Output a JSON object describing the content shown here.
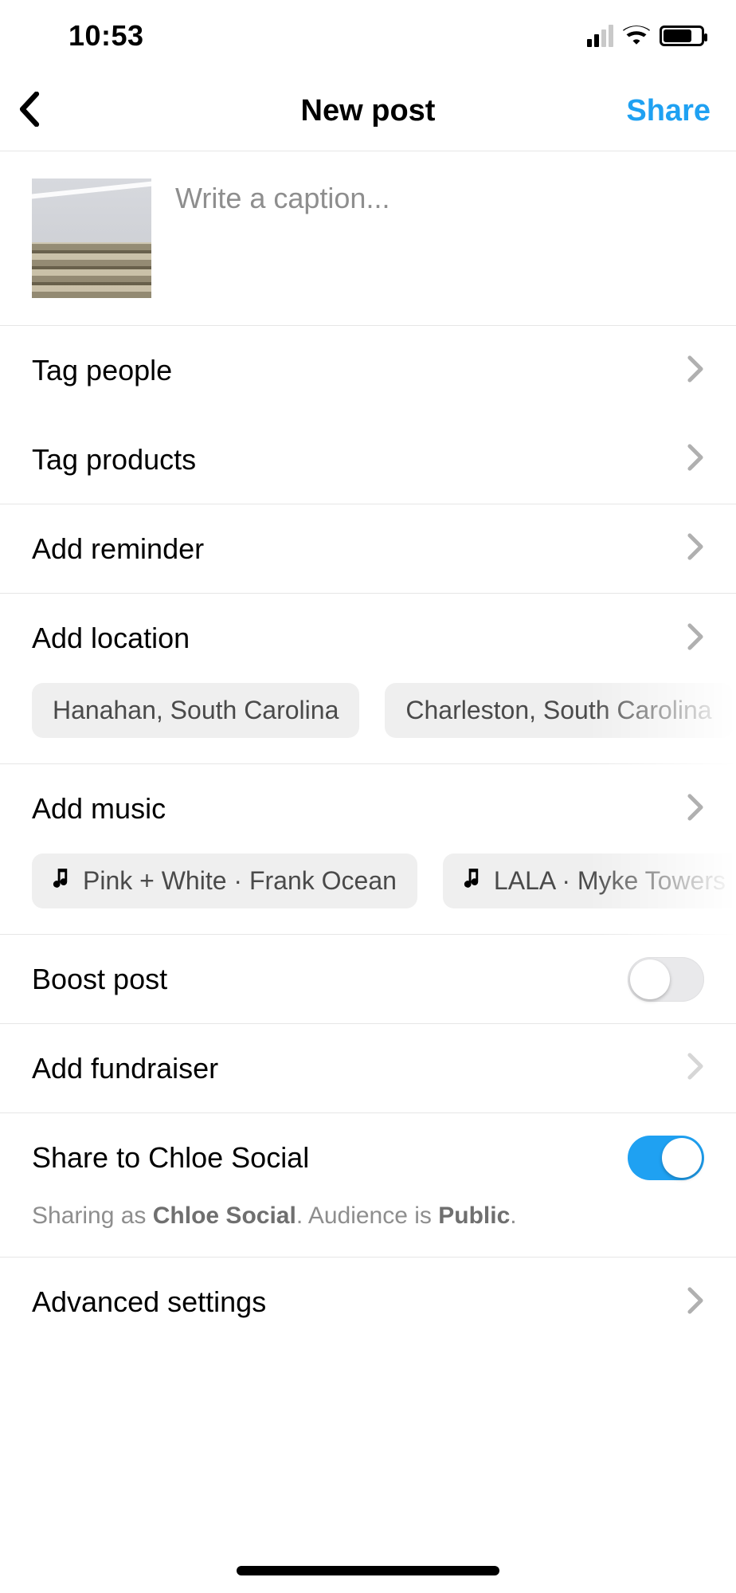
{
  "statusbar": {
    "time": "10:53"
  },
  "header": {
    "title": "New post",
    "share_label": "Share"
  },
  "caption": {
    "placeholder": "Write a caption..."
  },
  "rows": {
    "tag_people": "Tag people",
    "tag_products": "Tag products",
    "add_reminder": "Add reminder",
    "add_location": "Add location",
    "add_music": "Add music",
    "boost_post": "Boost post",
    "add_fundraiser": "Add fundraiser",
    "share_to": "Share to Chloe Social",
    "advanced": "Advanced settings"
  },
  "location_suggestions": [
    "Hanahan, South Carolina",
    "Charleston, South Carolina"
  ],
  "music_suggestions": [
    "Pink + White · Frank Ocean",
    "LALA · Myke Towers"
  ],
  "toggles": {
    "boost_post": false,
    "share_to": true
  },
  "share_note": {
    "prefix": "Sharing as ",
    "name": "Chloe Social",
    "middle": ". Audience is ",
    "audience": "Public",
    "suffix": "."
  }
}
